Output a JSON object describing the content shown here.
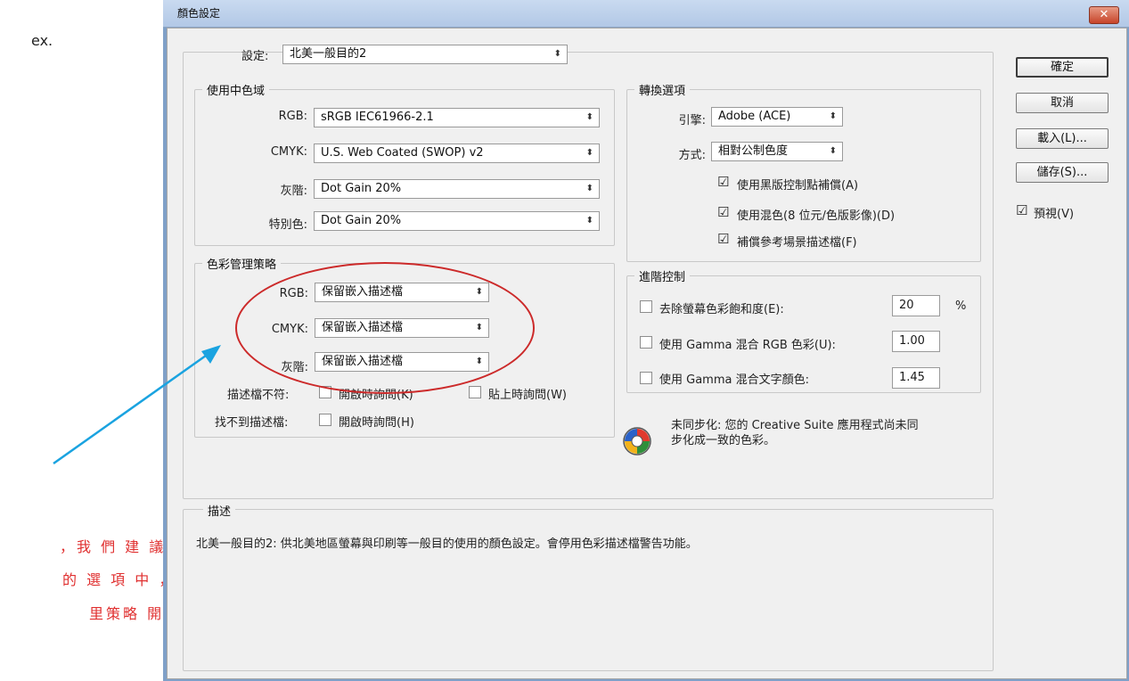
{
  "side": {
    "top_text": "ex.",
    "note_lines": [
      "，我 們 建 議",
      "的 選 項 中 ，",
      "里策略 開啟 。"
    ]
  },
  "dialog": {
    "title": "顏色設定",
    "close_glyph": "✕",
    "settings_label": "設定:",
    "settings_value": "北美一般目的2",
    "working_spaces": {
      "title": "使用中色域",
      "rows": [
        {
          "label": "RGB:",
          "value": "sRGB IEC61966-2.1"
        },
        {
          "label": "CMYK:",
          "value": "U.S. Web Coated (SWOP) v2"
        },
        {
          "label": "灰階:",
          "value": "Dot Gain 20%"
        },
        {
          "label": "特別色:",
          "value": "Dot Gain 20%"
        }
      ]
    },
    "policies": {
      "title": "色彩管理策略",
      "rows": [
        {
          "label": "RGB:",
          "value": "保留嵌入描述檔"
        },
        {
          "label": "CMYK:",
          "value": "保留嵌入描述檔"
        },
        {
          "label": "灰階:",
          "value": "保留嵌入描述檔"
        }
      ],
      "mismatch_label": "描述檔不符:",
      "mismatch_open": "開啟時詢問(K)",
      "mismatch_paste": "貼上時詢問(W)",
      "missing_label": "找不到描述檔:",
      "missing_open": "開啟時詢問(H)"
    },
    "conversion": {
      "title": "轉換選項",
      "engine_label": "引擎:",
      "engine_value": "Adobe (ACE)",
      "intent_label": "方式:",
      "intent_value": "相對公制色度",
      "options": [
        "使用黑版控制點補償(A)",
        "使用混色(8 位元/色版影像)(D)",
        "補償參考場景描述檔(F)"
      ]
    },
    "advanced": {
      "title": "進階控制",
      "desaturate_label": "去除螢幕色彩飽和度(E):",
      "desaturate_value": "20",
      "desaturate_unit": "%",
      "blend_rgb_label": "使用 Gamma 混合 RGB 色彩(U):",
      "blend_rgb_value": "1.00",
      "blend_text_label": "使用 Gamma 混合文字顏色:",
      "blend_text_value": "1.45"
    },
    "unsync_line1": "未同步化: 您的 Creative Suite 應用程式尚未同",
    "unsync_line2": "步化成一致的色彩。",
    "description": {
      "title": "描述",
      "text": "北美一般目的2: 供北美地區螢幕與印刷等一般目的使用的顏色設定。會停用色彩描述檔警告功能。"
    },
    "buttons": {
      "ok": "確定",
      "cancel": "取消",
      "load": "載入(L)...",
      "save": "儲存(S)..."
    },
    "preview_label": "預視(V)"
  },
  "colors": {
    "annotation_red": "#cc2a2a",
    "arrow_blue": "#1aa3e0",
    "note_red": "#e03030"
  }
}
